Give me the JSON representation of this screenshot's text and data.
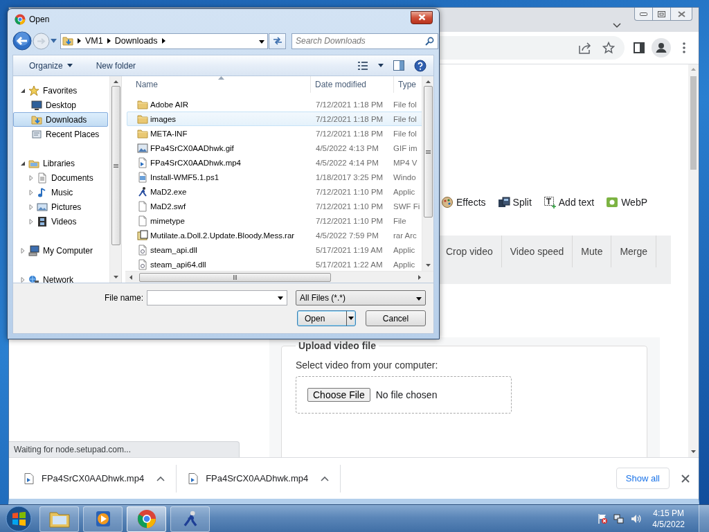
{
  "browser": {
    "tools": [
      {
        "label": "Effects",
        "kind": "effects"
      },
      {
        "label": "Split",
        "kind": "split"
      },
      {
        "label": "Add text",
        "kind": "text"
      },
      {
        "label": "WebP",
        "kind": "webp"
      }
    ],
    "tabs": [
      {
        "label": "Crop video",
        "selected": false
      },
      {
        "label": "Video speed",
        "selected": false
      },
      {
        "label": "Mute",
        "selected": false
      },
      {
        "label": "Merge",
        "selected": false
      }
    ],
    "upload": {
      "legend": "Upload video file",
      "prompt": "Select video from your computer:",
      "button": "Choose File",
      "status": "No file chosen"
    },
    "status_bubble": "Waiting for node.setupad.com...",
    "downloads": [
      {
        "name": "FPa4SrCX0AADhwk.mp4"
      },
      {
        "name": "FPa4SrCX0AADhwk.mp4"
      }
    ],
    "show_all": "Show all"
  },
  "dialog": {
    "title": "Open",
    "path": [
      "VM1",
      "Downloads"
    ],
    "search": {
      "placeholder": "Search Downloads"
    },
    "commands": [
      "Organize",
      "New folder"
    ],
    "nav": [
      {
        "label": "Favorites",
        "kind": "favorites",
        "expanded": true,
        "selected": false,
        "children": [
          {
            "label": "Desktop",
            "kind": "desktop",
            "selected": false
          },
          {
            "label": "Downloads",
            "kind": "downloads",
            "selected": true
          },
          {
            "label": "Recent Places",
            "kind": "recent",
            "selected": false
          }
        ]
      },
      {
        "label": "Libraries",
        "kind": "libraries",
        "expanded": true,
        "selected": false,
        "children": [
          {
            "label": "Documents",
            "kind": "documents",
            "expanded": false,
            "selected": false
          },
          {
            "label": "Music",
            "kind": "music",
            "expanded": false,
            "selected": false
          },
          {
            "label": "Pictures",
            "kind": "pictures",
            "expanded": false,
            "selected": false
          },
          {
            "label": "Videos",
            "kind": "videos",
            "expanded": false,
            "selected": false
          }
        ]
      },
      {
        "label": "My Computer",
        "kind": "computer",
        "expanded": false,
        "selected": false
      },
      {
        "label": "Network",
        "kind": "network",
        "expanded": false,
        "selected": false
      }
    ],
    "columns": [
      "Name",
      "Date modified",
      "Type"
    ],
    "files": [
      {
        "name": "Adobe AIR",
        "date": "7/12/2021 1:18 PM",
        "type": "File fol",
        "kind": "folder",
        "hovered": false
      },
      {
        "name": "images",
        "date": "7/12/2021 1:18 PM",
        "type": "File fol",
        "kind": "folder",
        "hovered": true
      },
      {
        "name": "META-INF",
        "date": "7/12/2021 1:18 PM",
        "type": "File fol",
        "kind": "folder",
        "hovered": false
      },
      {
        "name": "FPa4SrCX0AADhwk.gif",
        "date": "4/5/2022 4:13 PM",
        "type": "GIF im",
        "kind": "image",
        "hovered": false
      },
      {
        "name": "FPa4SrCX0AADhwk.mp4",
        "date": "4/5/2022 4:14 PM",
        "type": "MP4 V",
        "kind": "video",
        "hovered": false
      },
      {
        "name": "Install-WMF5.1.ps1",
        "date": "1/18/2017 3:25 PM",
        "type": "Windo",
        "kind": "script",
        "hovered": false
      },
      {
        "name": "MaD2.exe",
        "date": "7/12/2021 1:10 PM",
        "type": "Applic",
        "kind": "exe",
        "hovered": false
      },
      {
        "name": "MaD2.swf",
        "date": "7/12/2021 1:10 PM",
        "type": "SWF Fi",
        "kind": "blank",
        "hovered": false
      },
      {
        "name": "mimetype",
        "date": "7/12/2021 1:10 PM",
        "type": "File",
        "kind": "blank",
        "hovered": false
      },
      {
        "name": "Mutilate.a.Doll.2.Update.Bloody.Mess.rar",
        "date": "4/5/2022 7:59 PM",
        "type": "rar Arc",
        "kind": "archive",
        "hovered": false
      },
      {
        "name": "steam_api.dll",
        "date": "5/17/2021 1:19 AM",
        "type": "Applic",
        "kind": "dll",
        "hovered": false
      },
      {
        "name": "steam_api64.dll",
        "date": "5/17/2021 1:22 AM",
        "type": "Applic",
        "kind": "dll",
        "hovered": false
      }
    ],
    "file_name_label": "File name:",
    "filter": "All Files (*.*)",
    "buttons": [
      "Open",
      "Cancel"
    ]
  },
  "taskbar": {
    "apps": [
      {
        "kind": "explorer",
        "active": false
      },
      {
        "kind": "media",
        "active": false
      },
      {
        "kind": "browser",
        "active": true
      },
      {
        "kind": "game",
        "active": false
      }
    ],
    "clock": {
      "time": "4:15 PM",
      "date": "4/5/2022"
    }
  }
}
